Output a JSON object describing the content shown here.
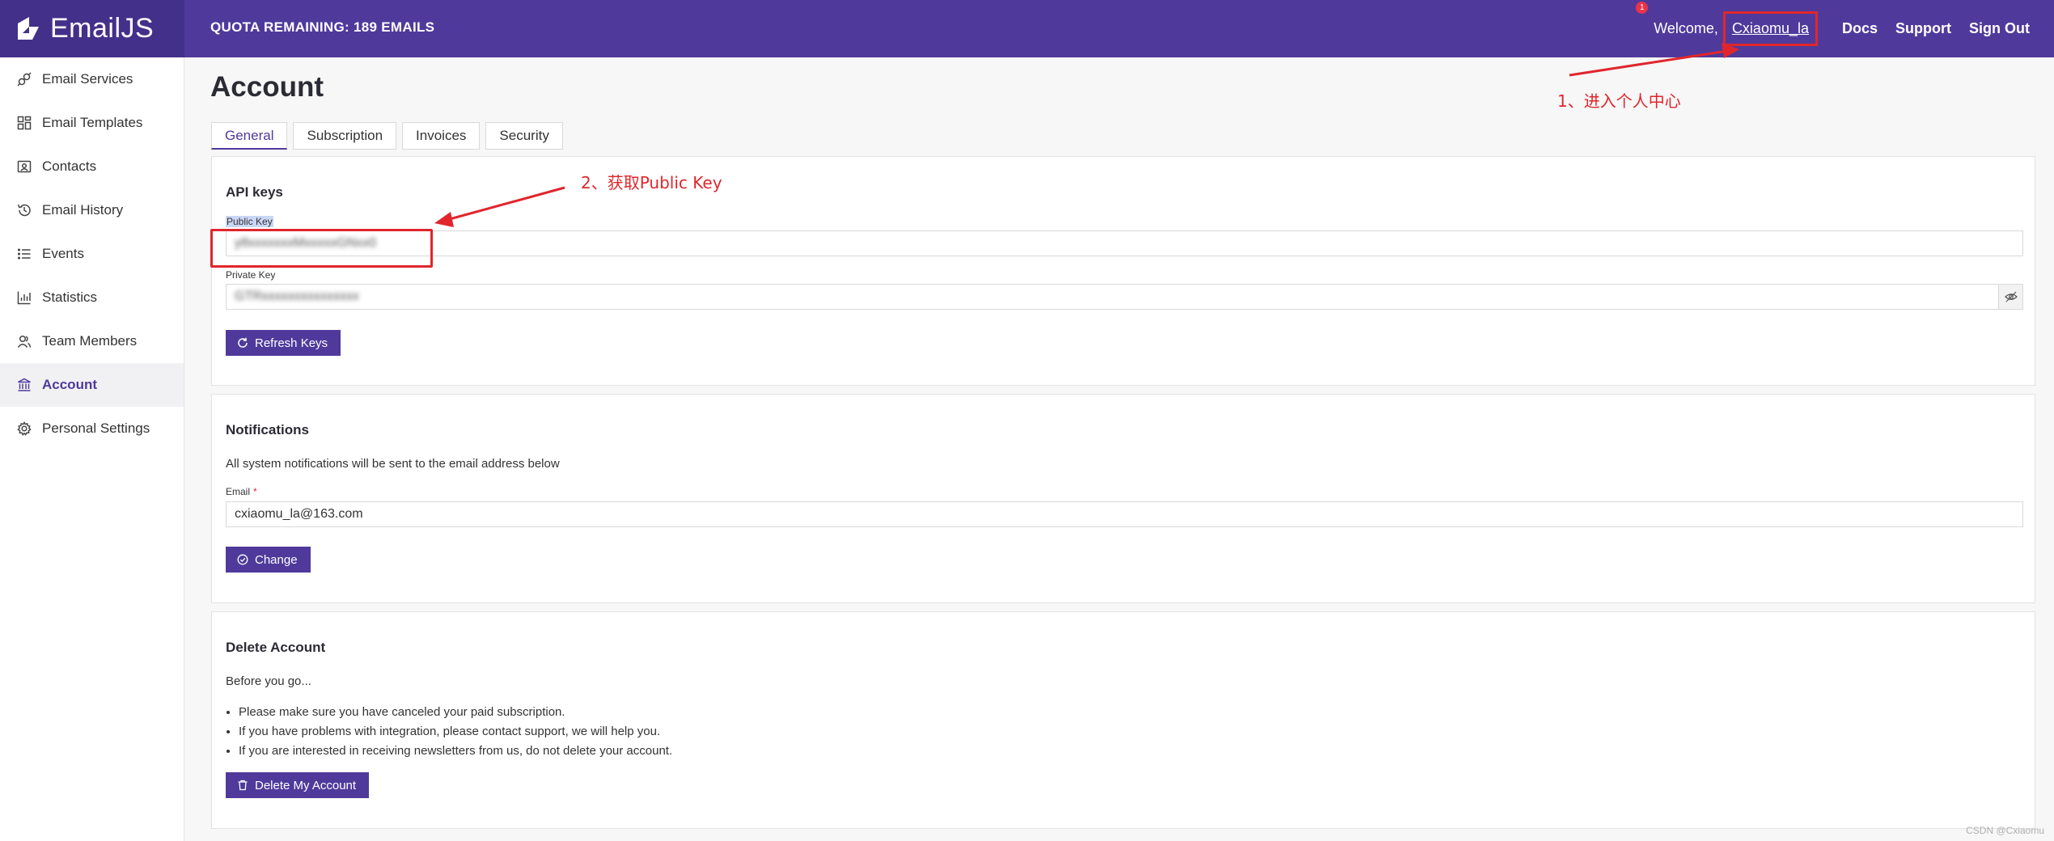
{
  "brand": {
    "name": "EmailJS"
  },
  "topbar": {
    "quota": "QUOTA REMAINING: 189 EMAILS",
    "notification_count": "1",
    "welcome": "Welcome,",
    "username": "Cxiaomu_la",
    "links": [
      "Docs",
      "Support",
      "Sign Out"
    ]
  },
  "sidebar": {
    "items": [
      {
        "label": "Email Services",
        "icon": "plug-icon"
      },
      {
        "label": "Email Templates",
        "icon": "templates-icon"
      },
      {
        "label": "Contacts",
        "icon": "contacts-icon"
      },
      {
        "label": "Email History",
        "icon": "history-icon"
      },
      {
        "label": "Events",
        "icon": "events-icon"
      },
      {
        "label": "Statistics",
        "icon": "statistics-icon"
      },
      {
        "label": "Team Members",
        "icon": "team-icon"
      },
      {
        "label": "Account",
        "icon": "bank-icon",
        "active": true
      },
      {
        "label": "Personal Settings",
        "icon": "gear-icon"
      }
    ]
  },
  "page": {
    "title": "Account",
    "tabs": [
      "General",
      "Subscription",
      "Invoices",
      "Security"
    ],
    "active_tab": "General"
  },
  "api_keys": {
    "title": "API keys",
    "public_key_label": "Public Key",
    "public_key_value": "y8xxxxxxxMxxxxxGNxx0",
    "private_key_label": "Private Key",
    "private_key_value": "GTRxxxxxxxxxxxxxxx",
    "refresh_button": "Refresh Keys"
  },
  "notifications": {
    "title": "Notifications",
    "description": "All system notifications will be sent to the email address below",
    "email_label": "Email",
    "required_mark": "*",
    "email_value": "cxiaomu_la@163.com",
    "change_button": "Change"
  },
  "delete_account": {
    "title": "Delete Account",
    "intro": "Before you go...",
    "bullets": [
      "Please make sure you have canceled your paid subscription.",
      "If you have problems with integration, please contact support, we will help you.",
      "If you are interested in receiving newsletters from us, do not delete your account."
    ],
    "delete_button": "Delete My Account"
  },
  "annotations": {
    "step1": "1、进入个人中心",
    "step2": "2、获取Public Key",
    "color": "#e0262c"
  },
  "watermark": "CSDN @Cxiaomu",
  "colors": {
    "accent": "#4f3a9c",
    "accent_dark": "#43308a",
    "annotation": "#e0262c"
  }
}
